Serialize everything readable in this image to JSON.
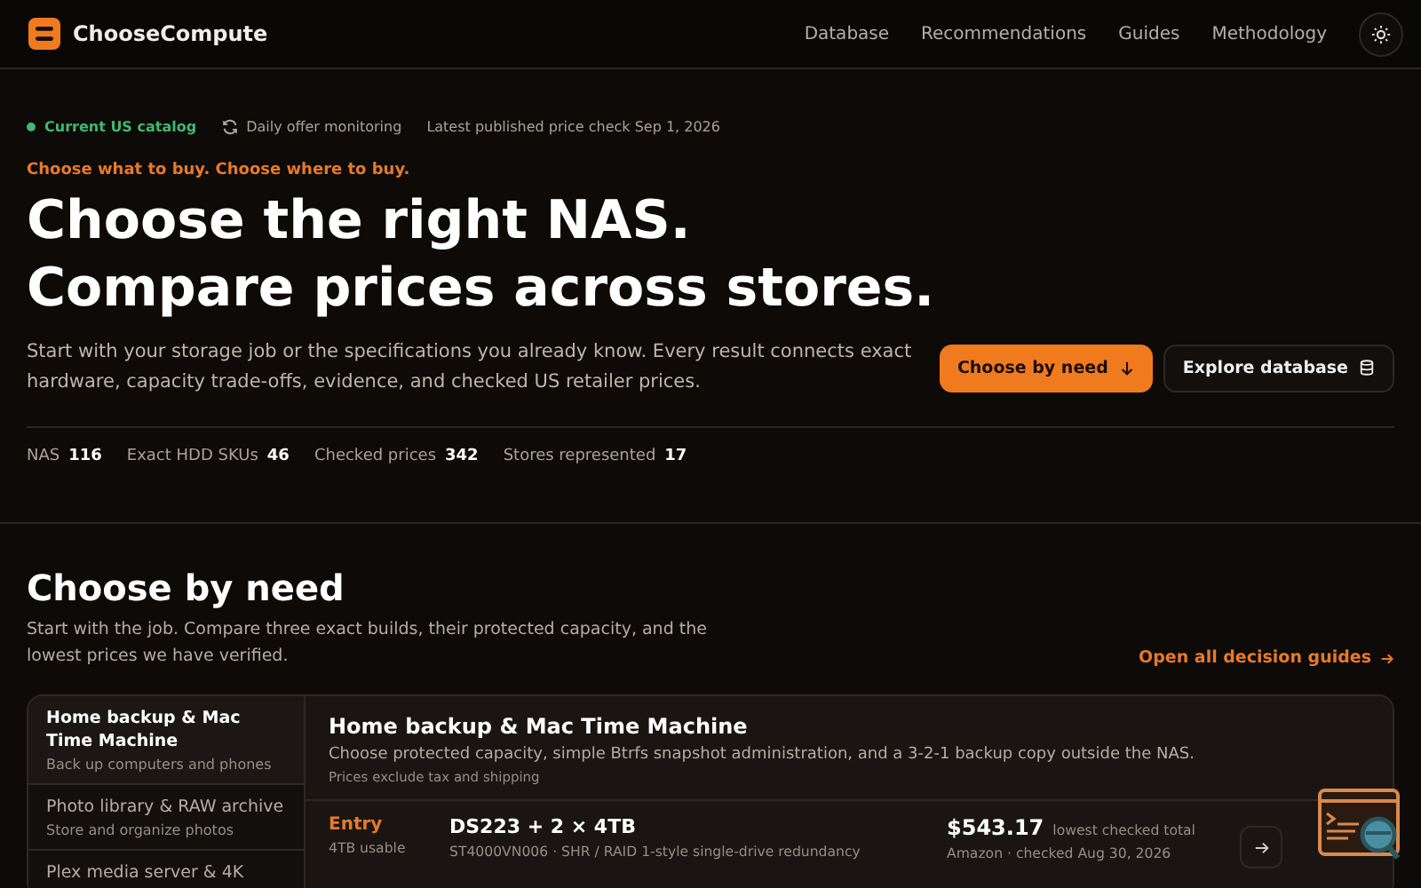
{
  "nav": {
    "brand": "ChooseCompute",
    "links": [
      "Database",
      "Recommendations",
      "Guides",
      "Methodology"
    ]
  },
  "meta": [
    {
      "kind": "status",
      "text": "Current US catalog",
      "color": "#3fb96f"
    },
    {
      "kind": "monitor",
      "text": "Daily offer monitoring"
    },
    {
      "kind": "plain",
      "text": "Latest published price check Sep 1, 2026"
    }
  ],
  "hero": {
    "eyebrow": "Choose what to buy. Choose where to buy.",
    "title_lines": [
      "Choose the right NAS.",
      "Compare prices across stores."
    ],
    "description": "Start with your storage job or the specifications you already know. Every result connects exact hardware, capacity trade-offs, evidence, and checked US retailer prices.",
    "buttons": [
      {
        "label": "Choose by need",
        "kind": "primary"
      },
      {
        "label": "Explore database",
        "kind": "secondary"
      }
    ],
    "stats": [
      {
        "label": "NAS",
        "value": "116"
      },
      {
        "label": "Exact HDD SKUs",
        "value": "46"
      },
      {
        "label": "Checked prices",
        "value": "342"
      },
      {
        "label": "Stores represented",
        "value": "17"
      }
    ]
  },
  "need": {
    "title": "Choose by need",
    "description": "Start with the job. Compare three exact builds, their protected capacity, and the lowest prices we have verified.",
    "link": "Open all decision guides",
    "items": [
      {
        "title": "Home backup & Mac Time Machine",
        "subtitle": "Back up computers and phones",
        "selected": true
      },
      {
        "title": "Photo library & RAW archive",
        "subtitle": "Store and organize photos",
        "selected": false
      },
      {
        "title": "Plex media server & 4K",
        "selected": false
      }
    ],
    "panel": {
      "title": "Home backup & Mac Time Machine",
      "description": "Choose protected capacity, simple Btrfs snapshot administration, and a 3-2-1 backup copy outside the NAS.",
      "note": "Prices exclude tax and shipping",
      "builds": [
        {
          "tier": "Entry",
          "usable": "4TB usable",
          "name": "DS223 + 2 × 4TB",
          "spec": "ST4000VN006 · SHR / RAID 1-style single-drive redundancy",
          "price": "$543.17",
          "price_note": "lowest checked total",
          "store": "Amazon · checked Aug 30, 2026"
        }
      ]
    }
  }
}
